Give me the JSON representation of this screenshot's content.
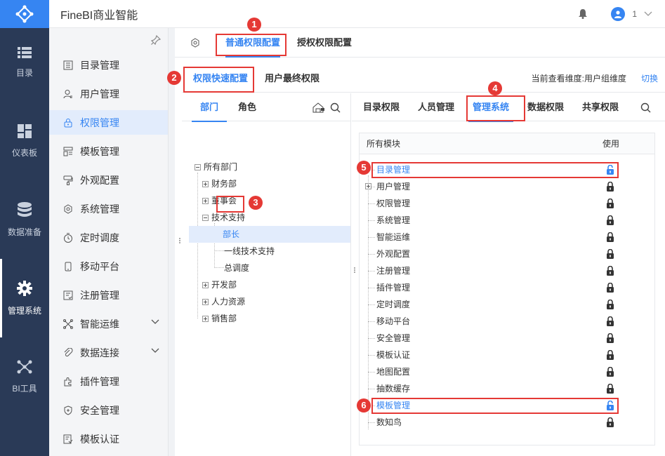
{
  "app": {
    "title": "FineBI商业智能",
    "user_name": "1"
  },
  "rail": {
    "items": [
      {
        "label": "目录",
        "icon": "list-icon"
      },
      {
        "label": "仪表板",
        "icon": "dashboard-icon"
      },
      {
        "label": "数据准备",
        "icon": "database-icon"
      },
      {
        "label": "管理系统",
        "icon": "gear-icon"
      },
      {
        "label": "BI工具",
        "icon": "tools-icon"
      }
    ]
  },
  "sidebar": {
    "items": [
      {
        "label": "目录管理",
        "icon": "catalog-icon"
      },
      {
        "label": "用户管理",
        "icon": "user-icon"
      },
      {
        "label": "权限管理",
        "icon": "lock-icon"
      },
      {
        "label": "模板管理",
        "icon": "template-icon"
      },
      {
        "label": "外观配置",
        "icon": "brush-icon"
      },
      {
        "label": "系统管理",
        "icon": "settings-icon"
      },
      {
        "label": "定时调度",
        "icon": "timer-icon"
      },
      {
        "label": "移动平台",
        "icon": "mobile-icon"
      },
      {
        "label": "注册管理",
        "icon": "register-icon"
      },
      {
        "label": "智能运维",
        "icon": "ops-icon"
      },
      {
        "label": "数据连接",
        "icon": "link-icon"
      },
      {
        "label": "插件管理",
        "icon": "plugin-icon"
      },
      {
        "label": "安全管理",
        "icon": "shield-icon"
      },
      {
        "label": "模板认证",
        "icon": "certify-icon"
      }
    ]
  },
  "tabs": {
    "top": [
      "普通权限配置",
      "授权权限配置"
    ],
    "sub": [
      "权限快速配置",
      "用户最终权限"
    ],
    "dimension_text": "当前查看维度:用户组维度",
    "switch_label": "切换"
  },
  "tree": {
    "tabs": [
      "部门",
      "角色"
    ],
    "nodes": [
      "所有部门",
      "财务部",
      "董事会",
      "技术支持",
      "部长",
      "一线技术支持",
      "总调度",
      "开发部",
      "人力资源",
      "销售部"
    ]
  },
  "perm": {
    "tabs": [
      "目录权限",
      "人员管理",
      "管理系统",
      "数据权限",
      "共享权限"
    ],
    "head_module": "所有模块",
    "head_use": "使用",
    "rows": [
      "目录管理",
      "用户管理",
      "权限管理",
      "系统管理",
      "智能运维",
      "外观配置",
      "注册管理",
      "插件管理",
      "定时调度",
      "移动平台",
      "安全管理",
      "模板认证",
      "地图配置",
      "抽数缓存",
      "模板管理",
      "数知鸟"
    ]
  },
  "markers": [
    "1",
    "2",
    "3",
    "4",
    "5",
    "6"
  ],
  "colors": {
    "accent": "#3685f2",
    "rail_bg": "#2a3a57",
    "annotation": "#e53935"
  }
}
